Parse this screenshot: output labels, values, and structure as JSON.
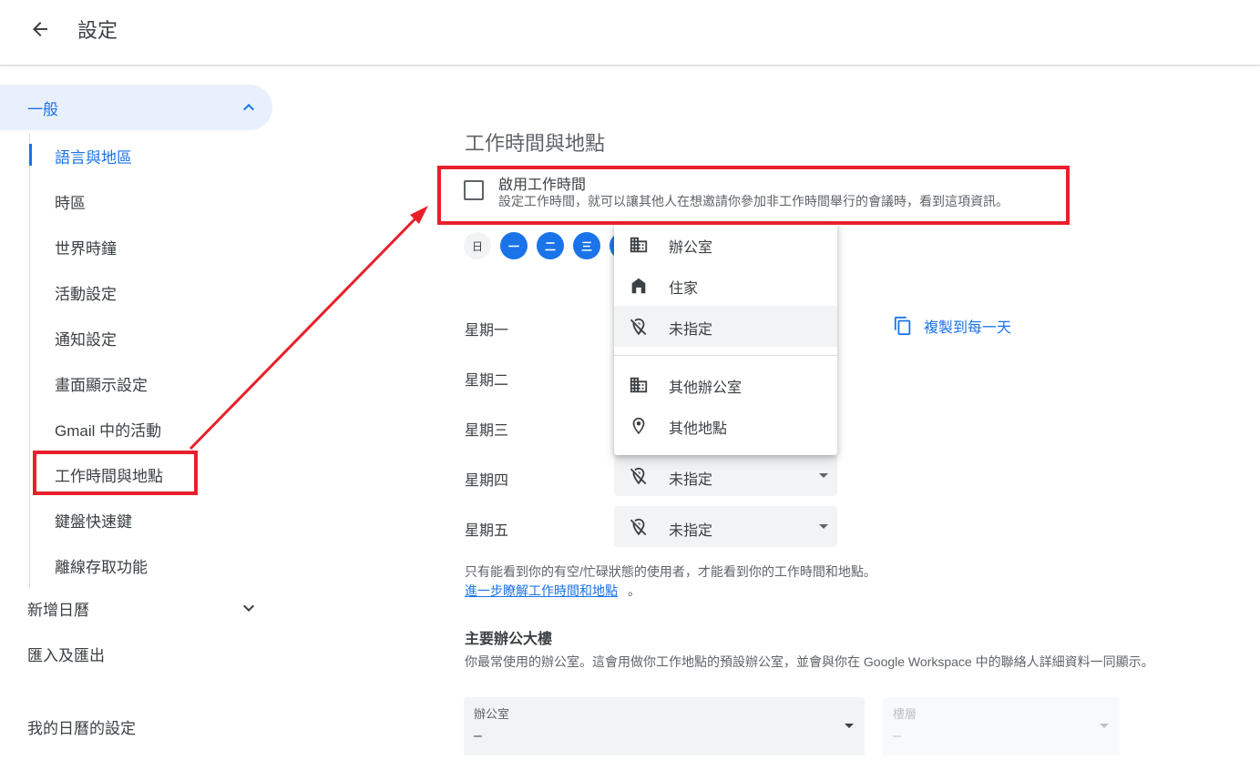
{
  "header": {
    "title": "設定"
  },
  "sidebar": {
    "general_label": "一般",
    "items": [
      {
        "label": "語言與地區"
      },
      {
        "label": "時區"
      },
      {
        "label": "世界時鐘"
      },
      {
        "label": "活動設定"
      },
      {
        "label": "通知設定"
      },
      {
        "label": "畫面顯示設定"
      },
      {
        "label": "Gmail 中的活動"
      },
      {
        "label": "工作時間與地點"
      },
      {
        "label": "鍵盤快速鍵"
      },
      {
        "label": "離線存取功能"
      }
    ],
    "add_calendar": "新增日曆",
    "import_export": "匯入及匯出",
    "my_calendars": "我的日曆的設定"
  },
  "main": {
    "section_title": "工作時間與地點",
    "enable_checkbox": {
      "label": "啟用工作時間",
      "description": "設定工作時間，就可以讓其他人在想邀請你參加非工作時間舉行的會議時，看到這項資訊。",
      "checked": false
    },
    "day_chips": [
      {
        "label": "日",
        "selected": false
      },
      {
        "label": "一",
        "selected": true
      },
      {
        "label": "二",
        "selected": true
      },
      {
        "label": "三",
        "selected": true
      }
    ],
    "weekday_rows": [
      {
        "label": "星期一"
      },
      {
        "label": "星期二"
      },
      {
        "label": "星期三"
      },
      {
        "label": "星期四",
        "location": "未指定"
      },
      {
        "label": "星期五",
        "location": "未指定"
      }
    ],
    "copy_to_all": "複製到每一天",
    "location_menu": [
      {
        "label": "辦公室",
        "icon": "building-icon"
      },
      {
        "label": "住家",
        "icon": "home-icon"
      },
      {
        "label": "未指定",
        "icon": "location-off-icon",
        "highlighted": true
      },
      {
        "label": "其他辦公室",
        "icon": "building-icon"
      },
      {
        "label": "其他地點",
        "icon": "location-pin-icon"
      }
    ],
    "visibility_note": "只有能看到你的有空/忙碌狀態的使用者，才能看到你的工作時間和地點。",
    "learn_more_link": "進一步瞭解工作時間和地點",
    "learn_more_tail": "。",
    "primary_building": {
      "title": "主要辦公大樓",
      "description": "你最常使用的辦公室。這會用做你工作地點的預設辦公室，並會與你在 Google Workspace 中的聯絡人詳細資料一同顯示。",
      "office_field": {
        "label": "辦公室",
        "value": "–"
      },
      "floor_field": {
        "label": "樓層",
        "value": "–"
      }
    }
  },
  "colors": {
    "accent": "#1a73e8",
    "annotation": "#e8202a"
  }
}
